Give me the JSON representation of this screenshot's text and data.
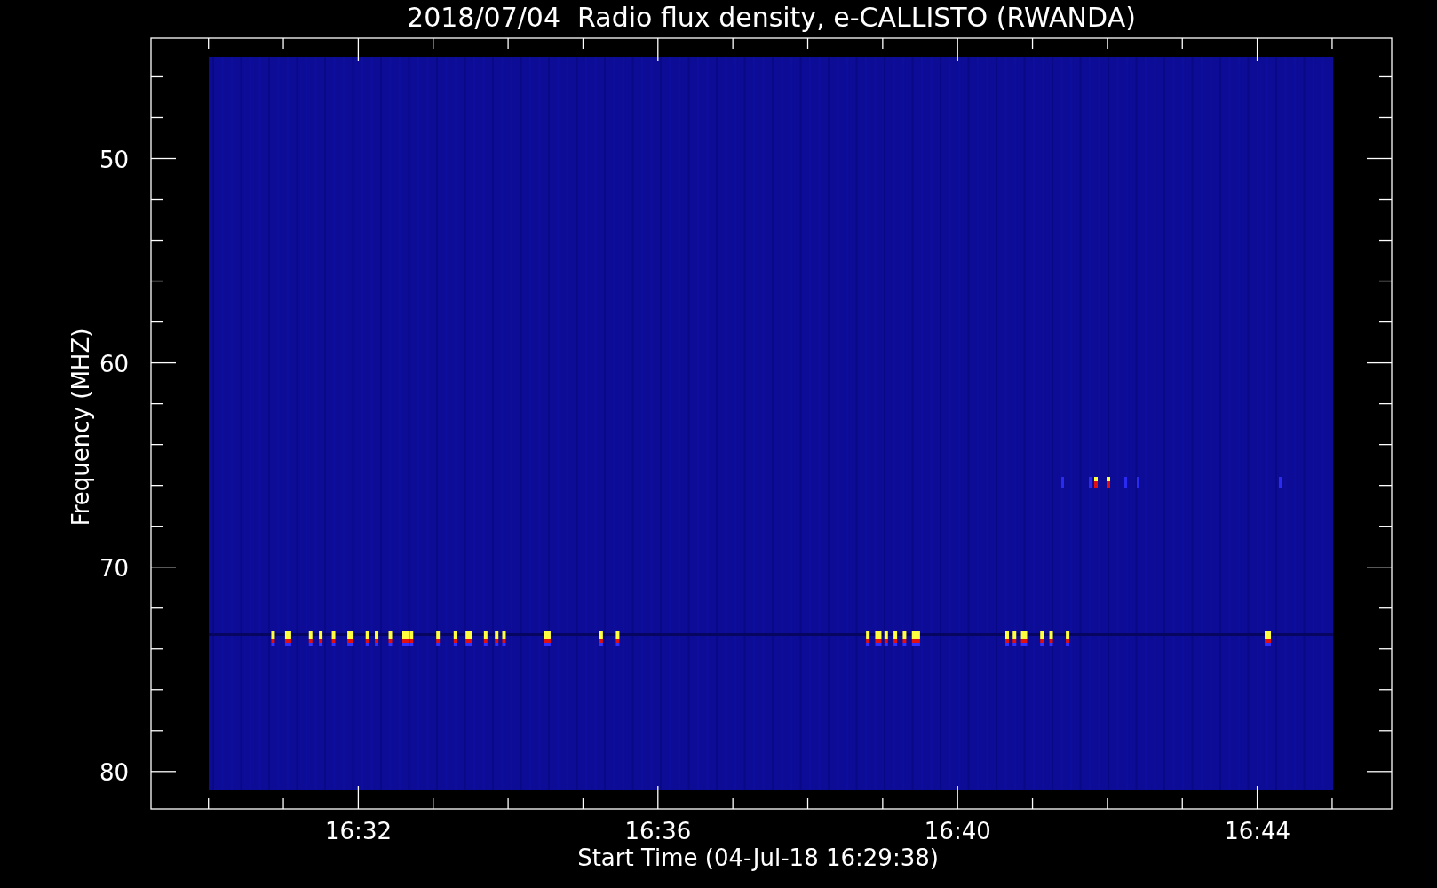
{
  "title": "2018/07/04  Radio flux density, e-CALLISTO (RWANDA)",
  "plot": {
    "ylabel": "Frequency (MHZ)",
    "xlabel": "Start Time (04-Jul-18 16:29:38)",
    "ytick_labels": [
      "50",
      "60",
      "70",
      "80"
    ],
    "xtick_labels": [
      "16:32",
      "16:36",
      "16:40",
      "16:44"
    ]
  }
}
